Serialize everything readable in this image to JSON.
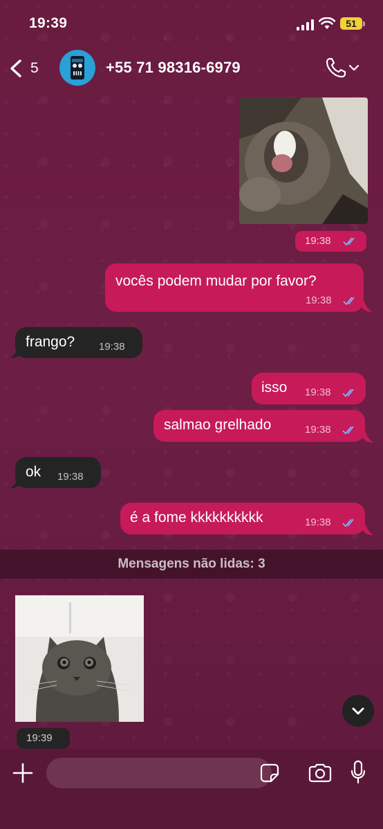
{
  "status_bar": {
    "time": "19:39",
    "battery": "51"
  },
  "header": {
    "back_count": "5",
    "contact_name": "+55 71 98316-6979"
  },
  "messages": [
    {
      "type": "image",
      "direction": "out",
      "time": "19:38"
    },
    {
      "type": "text",
      "direction": "out",
      "text": "vocês podem mudar por favor?",
      "time": "19:38"
    },
    {
      "type": "text",
      "direction": "in",
      "text": "frango?",
      "time": "19:38"
    },
    {
      "type": "text",
      "direction": "out",
      "text": "isso",
      "time": "19:38"
    },
    {
      "type": "text",
      "direction": "out",
      "text": "salmao grelhado",
      "time": "19:38"
    },
    {
      "type": "text",
      "direction": "in",
      "text": "ok",
      "time": "19:38"
    },
    {
      "type": "text",
      "direction": "out",
      "text": "é a fome kkkkkkkkkk",
      "time": "19:38"
    },
    {
      "type": "image",
      "direction": "in",
      "time": "19:39"
    }
  ],
  "unread_divider": "Mensagens não lidas: 3",
  "input": {
    "placeholder": ""
  },
  "colors": {
    "outgoing_bubble": "#c61a59",
    "incoming_bubble": "#242424",
    "read_ticks": "#7fb2ff",
    "battery": "#f2d038"
  }
}
